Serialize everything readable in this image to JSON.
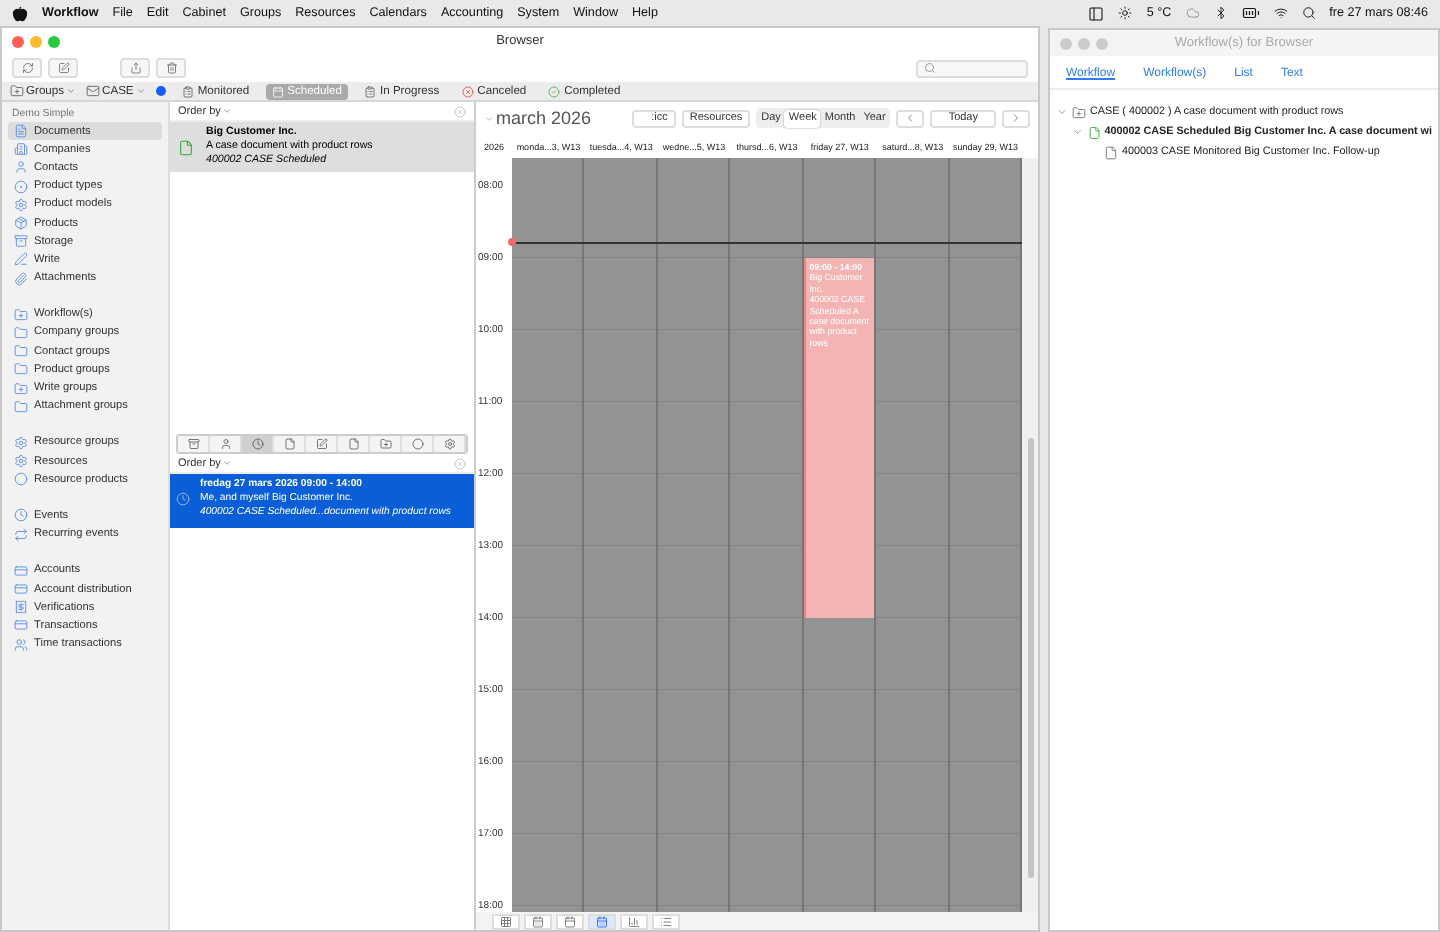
{
  "menu_bar": {
    "app": "Workflow",
    "items": [
      "File",
      "Edit",
      "Cabinet",
      "Groups",
      "Resources",
      "Calendars",
      "Accounting",
      "System",
      "Window",
      "Help"
    ],
    "weather": "5 °C",
    "clock": "fre 27 mars 08:46"
  },
  "browser": {
    "title": "Browser",
    "filter_bar": {
      "groups": "Groups",
      "case": "CASE",
      "statuses": [
        {
          "label": "Monitored",
          "selected": false
        },
        {
          "label": "Scheduled",
          "selected": true
        },
        {
          "label": "In Progress",
          "selected": false
        },
        {
          "label": "Canceled",
          "selected": false
        },
        {
          "label": "Completed",
          "selected": false
        }
      ]
    },
    "sidebar": {
      "section": "Demo Simple",
      "groups": [
        [
          {
            "label": "Documents",
            "selected": true
          },
          {
            "label": "Companies",
            "selected": false
          },
          {
            "label": "Contacts",
            "selected": false
          },
          {
            "label": "Product types",
            "selected": false
          },
          {
            "label": "Product models",
            "selected": false
          },
          {
            "label": "Products",
            "selected": false
          },
          {
            "label": "Storage",
            "selected": false
          },
          {
            "label": "Write",
            "selected": false
          },
          {
            "label": "Attachments",
            "selected": false
          }
        ],
        [
          {
            "label": "Workflow(s)",
            "selected": false
          },
          {
            "label": "Company groups",
            "selected": false
          },
          {
            "label": "Contact groups",
            "selected": false
          },
          {
            "label": "Product groups",
            "selected": false
          },
          {
            "label": "Write groups",
            "selected": false
          },
          {
            "label": "Attachment groups",
            "selected": false
          }
        ],
        [
          {
            "label": "Resource groups",
            "selected": false
          },
          {
            "label": "Resources",
            "selected": false
          },
          {
            "label": "Resource products",
            "selected": false
          }
        ],
        [
          {
            "label": "Events",
            "selected": false
          },
          {
            "label": "Recurring events",
            "selected": false
          }
        ],
        [
          {
            "label": "Accounts",
            "selected": false
          },
          {
            "label": "Account distribution",
            "selected": false
          },
          {
            "label": "Verifications",
            "selected": false
          },
          {
            "label": "Transactions",
            "selected": false
          },
          {
            "label": "Time transactions",
            "selected": false
          }
        ]
      ]
    },
    "documents": {
      "order_by": "Order by",
      "items": [
        {
          "title": "Big Customer Inc.",
          "subtitle": "A case document with product rows",
          "status": "400002 CASE Scheduled",
          "selected": true
        }
      ]
    },
    "lower_tabs": [
      {
        "selected": false
      },
      {
        "selected": false
      },
      {
        "selected": true
      },
      {
        "selected": false
      },
      {
        "selected": false
      },
      {
        "selected": false
      },
      {
        "selected": false
      },
      {
        "selected": false
      },
      {
        "selected": false
      }
    ],
    "events": {
      "order_by": "Order by",
      "items": [
        {
          "date": "fredag 27 mars 2026 09:00 - 14:00",
          "people": "Me, and myself Big Customer Inc.",
          "summary": "400002 CASE Scheduled...document with product rows",
          "selected": true
        }
      ]
    },
    "calendar": {
      "month": "march 2026",
      "search": ":icc",
      "resources": "Resources",
      "views": [
        {
          "label": "Day",
          "selected": false
        },
        {
          "label": "Week",
          "selected": true
        },
        {
          "label": "Month",
          "selected": false
        },
        {
          "label": "Year",
          "selected": false
        }
      ],
      "today": "Today",
      "year": "2026",
      "days": [
        {
          "label": "monda...3, W13"
        },
        {
          "label": "tuesda...4, W13"
        },
        {
          "label": "wedne...5, W13"
        },
        {
          "label": "thursd...6, W13"
        },
        {
          "label": "friday 27, W13",
          "events": [
            {
              "time": "09:00 - 14:00",
              "title": "Big Customer Inc.",
              "text": "400002 CASE Scheduled A case document with product rows"
            }
          ]
        },
        {
          "label": "saturd...8, W13"
        },
        {
          "label": "sunday 29, W13"
        }
      ],
      "hours": [
        "08:00",
        "09:00",
        "10:00",
        "11:00",
        "12:00",
        "13:00",
        "14:00",
        "15:00",
        "16:00",
        "17:00",
        "18:00"
      ],
      "bottom_tools": [
        {
          "selected": false
        },
        {
          "selected": false
        },
        {
          "selected": false
        },
        {
          "selected": true
        },
        {
          "selected": false
        },
        {
          "selected": false
        }
      ]
    }
  },
  "side_window": {
    "title": "Workflow(s) for Browser",
    "tabs": [
      {
        "label": "Workflow",
        "selected": true
      },
      {
        "label": "Workflow(s)",
        "selected": false
      },
      {
        "label": "List",
        "selected": false
      },
      {
        "label": "Text",
        "selected": false
      }
    ],
    "tree": [
      {
        "label": "CASE ( 400002 ) A case document with product rows",
        "current": false,
        "expanded": true,
        "children": [
          {
            "label": "400002 CASE Scheduled Big Customer Inc. A case document wi",
            "current": true,
            "expanded": true,
            "children": [
              {
                "label": "400003 CASE Monitored Big Customer Inc. Follow-up",
                "current": false,
                "expanded": false
              }
            ]
          }
        ]
      }
    ]
  }
}
